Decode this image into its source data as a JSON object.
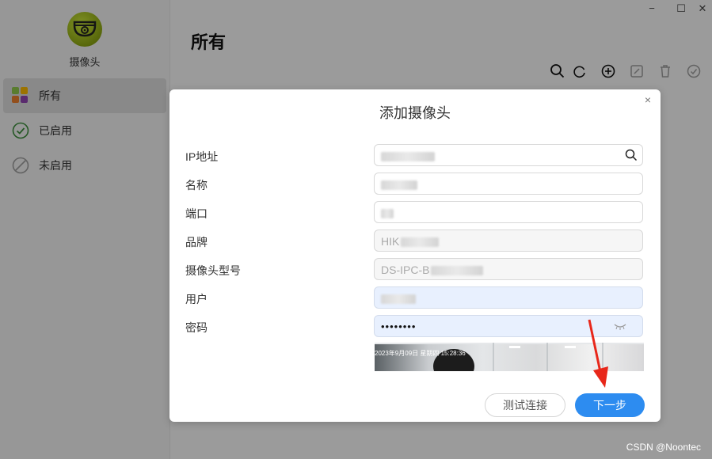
{
  "app": {
    "name": "摄像头"
  },
  "sidebar": {
    "items": [
      {
        "label": "所有",
        "icon": "apps-grid-icon",
        "active": true
      },
      {
        "label": "已启用",
        "icon": "check-circle-icon",
        "active": false
      },
      {
        "label": "未启用",
        "icon": "disabled-circle-icon",
        "active": false
      }
    ]
  },
  "main": {
    "title": "所有"
  },
  "toolbar": {
    "icons": [
      "search-icon",
      "refresh-icon",
      "add-icon",
      "edit-icon",
      "delete-icon",
      "confirm-icon"
    ]
  },
  "window_controls": {
    "minimize": "−",
    "maximize": "☐",
    "close": "✕"
  },
  "dialog": {
    "title": "添加摄像头",
    "close": "×",
    "fields": [
      {
        "label": "IP地址",
        "value": ""
      },
      {
        "label": "名称",
        "value": ""
      },
      {
        "label": "端口",
        "value": ""
      },
      {
        "label": "品牌",
        "value": "HIK"
      },
      {
        "label": "摄像头型号",
        "value": "DS-IPC-B"
      },
      {
        "label": "用户",
        "value": ""
      },
      {
        "label": "密码",
        "value": "••••••••"
      }
    ],
    "preview_overlay": "2023年9月09日 星期四 15:28:36",
    "buttons": {
      "test": "测试连接",
      "next": "下一步"
    }
  },
  "watermark": "CSDN @Noontec",
  "colors": {
    "accent": "#2d8cf0",
    "arrow": "#e8271a",
    "logo": "#8aa312"
  }
}
